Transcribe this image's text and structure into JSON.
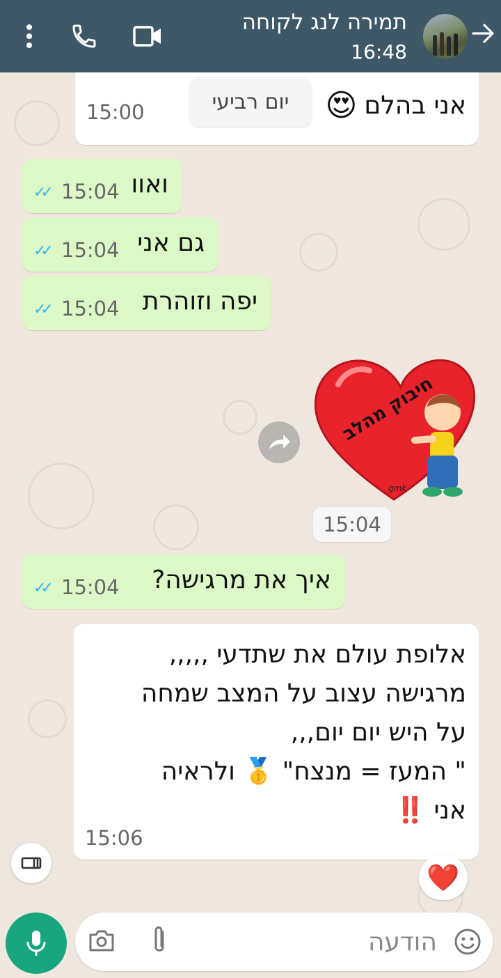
{
  "header": {
    "contact_name": "תמירה לנג לקוחה",
    "subtitle": "16:48"
  },
  "chat": {
    "day_chip": "יום רביעי",
    "messages": [
      {
        "direction": "in",
        "text": "אני בהלם",
        "emoji": "😍",
        "time": "15:00"
      },
      {
        "direction": "out",
        "text": "ואוו",
        "time": "15:04"
      },
      {
        "direction": "out",
        "text": "גם אני",
        "time": "15:04"
      },
      {
        "direction": "out",
        "text": "יפה וזוהרת",
        "time": "15:04"
      },
      {
        "direction": "in",
        "type": "sticker",
        "sticker_text": "חיבוק מהלב",
        "sticker_signature": "gmk",
        "time": "15:04"
      },
      {
        "direction": "out",
        "text": "איך את מרגישה?",
        "time": "15:04"
      },
      {
        "direction": "in",
        "lines": [
          "אלופת עולם את שתדעי ,,,,,",
          "מרגישה עצוב על המצב שמחה",
          "על היש יום יום,,,",
          "\" המעז = מנצח\" 🥇 ולראיה",
          "אני ‼️"
        ],
        "time": "15:06",
        "reaction": "❤️"
      }
    ]
  },
  "composer": {
    "placeholder": "הודעה"
  }
}
